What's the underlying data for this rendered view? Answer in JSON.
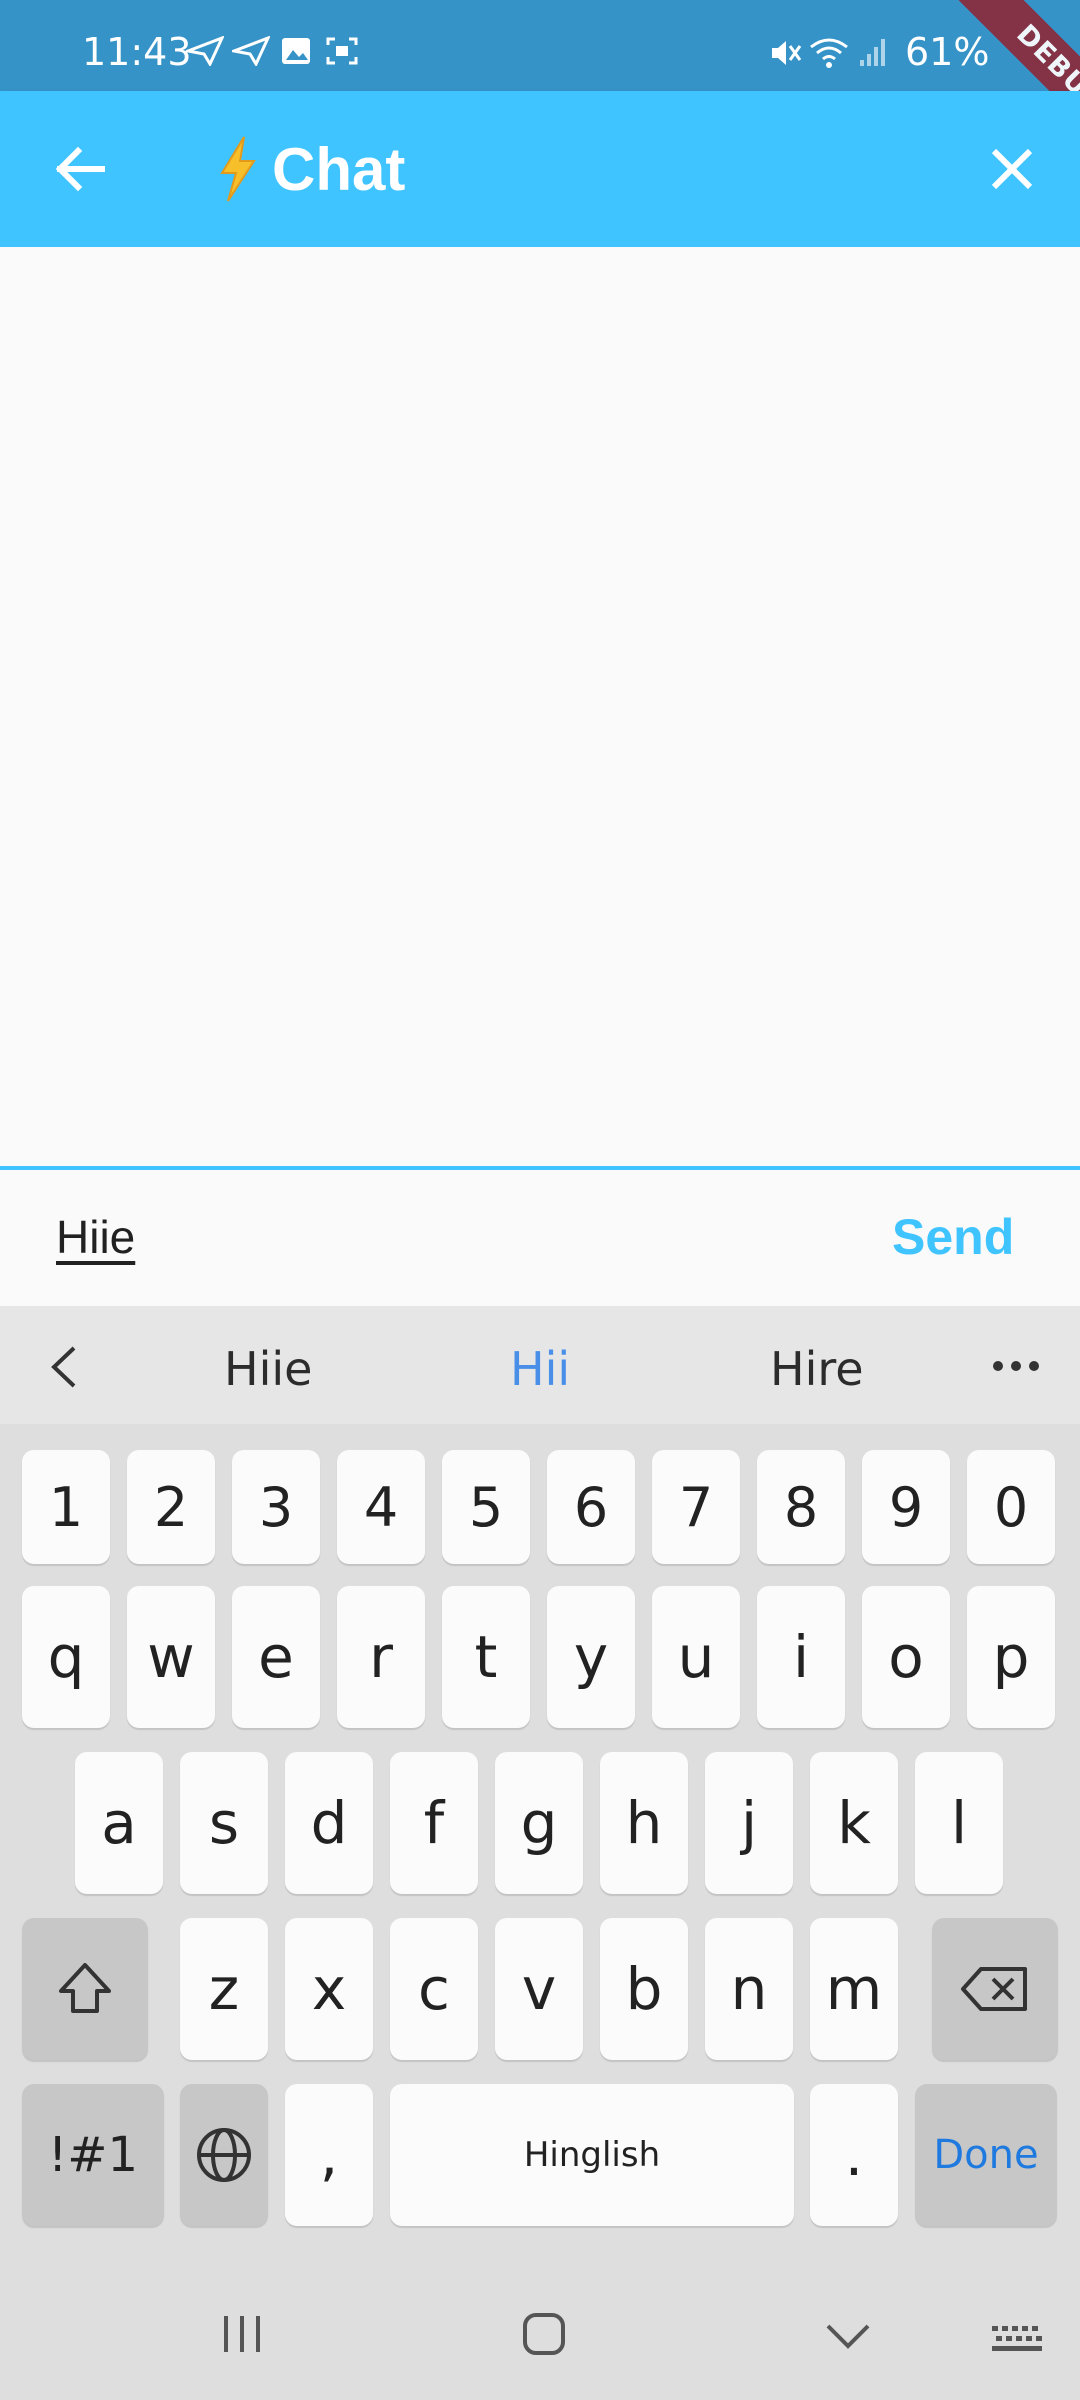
{
  "status_bar": {
    "time": "11:43",
    "battery": "61%"
  },
  "debug_banner": "DEBUG",
  "app_bar": {
    "title": "Chat",
    "color": "#40c4ff"
  },
  "composer": {
    "input_value": "Hiie",
    "send_label": "Send"
  },
  "keyboard": {
    "suggestions": [
      "Hiie",
      "Hii",
      "Hire"
    ],
    "highlighted_suggestion_color": "#4a8fe7",
    "number_row": [
      "1",
      "2",
      "3",
      "4",
      "5",
      "6",
      "7",
      "8",
      "9",
      "0"
    ],
    "row1": [
      "q",
      "w",
      "e",
      "r",
      "t",
      "y",
      "u",
      "i",
      "o",
      "p"
    ],
    "row2": [
      "a",
      "s",
      "d",
      "f",
      "g",
      "h",
      "j",
      "k",
      "l"
    ],
    "row3": [
      "z",
      "x",
      "c",
      "v",
      "b",
      "n",
      "m"
    ],
    "symbols_label": "!#1",
    "comma_label": ",",
    "space_label": "Hinglish",
    "period_label": ".",
    "done_label": "Done"
  }
}
